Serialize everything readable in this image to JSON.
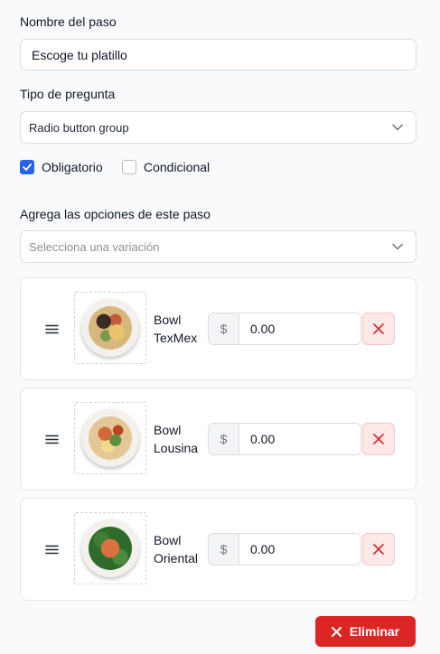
{
  "step": {
    "name_label": "Nombre del paso",
    "name_value": "Escoge tu platillo",
    "type_label": "Tipo de pregunta",
    "type_value": "Radio button group"
  },
  "flags": {
    "required_label": "Obligatorio",
    "required_checked": true,
    "conditional_label": "Condicional",
    "conditional_checked": false
  },
  "options_section": {
    "label": "Agrega las opciones de este paso",
    "variation_placeholder": "Selecciona una variación"
  },
  "options": [
    {
      "name_line1": "Bowl",
      "name_line2": "TexMex",
      "currency": "$",
      "price": "0.00"
    },
    {
      "name_line1": "Bowl",
      "name_line2": "Lousina",
      "currency": "$",
      "price": "0.00"
    },
    {
      "name_line1": "Bowl",
      "name_line2": "Oriental",
      "currency": "$",
      "price": "0.00"
    }
  ],
  "footer": {
    "delete_label": "Eliminar"
  },
  "colors": {
    "primary": "#2563eb",
    "danger": "#dc2626",
    "danger_soft": "#fde8e8"
  },
  "icons": [
    "chevron-down-icon",
    "check-icon",
    "drag-handle-icon",
    "close-icon"
  ]
}
